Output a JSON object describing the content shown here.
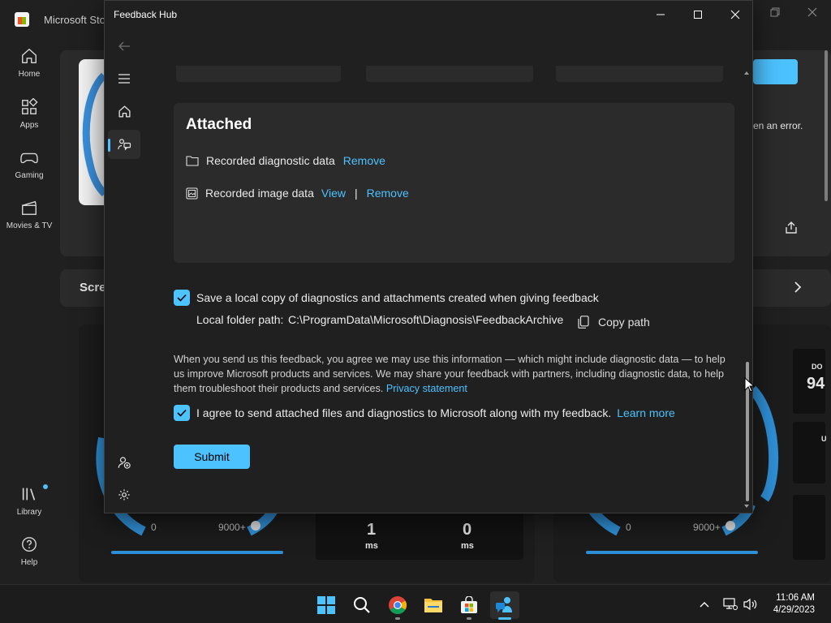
{
  "store": {
    "title": "Microsoft Store",
    "nav": [
      {
        "label": "Home",
        "icon": "home-icon"
      },
      {
        "label": "Apps",
        "icon": "apps-icon"
      },
      {
        "label": "Gaming",
        "icon": "gaming-icon"
      },
      {
        "label": "Movies & TV",
        "icon": "movies-icon"
      },
      {
        "label": "Library",
        "icon": "library-icon"
      },
      {
        "label": "Help",
        "icon": "help-icon"
      }
    ],
    "partial_error_text": "en an error.",
    "partial_section_title": "Scre",
    "gauge_left_labels": [
      "0",
      "9000+"
    ],
    "gauge_right_labels": [
      "0",
      "9000+"
    ],
    "ping": {
      "value": "1",
      "unit": "ms"
    },
    "jitter": {
      "value": "0",
      "unit": "ms"
    },
    "partial_download_label": "DO",
    "partial_download_value": "94",
    "partial_upload_label": "U"
  },
  "feedback_hub": {
    "title": "Feedback Hub",
    "attached": {
      "heading": "Attached",
      "items": [
        {
          "label": "Recorded diagnostic data",
          "actions": [
            "Remove"
          ]
        },
        {
          "label": "Recorded image data",
          "actions": [
            "View",
            "Remove"
          ],
          "separator": "|"
        }
      ]
    },
    "save_copy": {
      "checked": true,
      "label": "Save a local copy of diagnostics and attachments created when giving feedback",
      "path_label": "Local folder path:",
      "path_value": "C:\\ProgramData\\Microsoft\\Diagnosis\\FeedbackArchive",
      "copy_label": "Copy path"
    },
    "legal_text": "When you send us this feedback, you agree we may use this information — which might include diagnostic data — to help us improve Microsoft products and services. We may share your feedback with partners, including diagnostic data, to help them troubleshoot their products and services.",
    "privacy_link": "Privacy statement",
    "agree": {
      "checked": true,
      "label": "I agree to send attached files and diagnostics to Microsoft along with my feedback.",
      "learn_more": "Learn more"
    },
    "submit_label": "Submit"
  },
  "taskbar": {
    "apps": [
      "start-icon",
      "search-icon",
      "chrome-icon",
      "file-explorer-icon",
      "microsoft-store-icon",
      "feedback-hub-icon"
    ],
    "time": "11:06 AM",
    "date": "4/29/2023"
  },
  "colors": {
    "accent": "#4cc2ff",
    "window_bg": "#202020",
    "card_bg": "#2b2b2b"
  }
}
